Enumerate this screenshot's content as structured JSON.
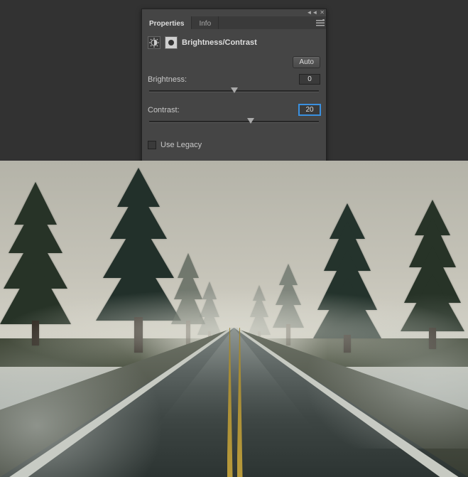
{
  "tabs": {
    "properties": "Properties",
    "info": "Info"
  },
  "adjustment": {
    "title": "Brightness/Contrast",
    "auto_label": "Auto",
    "brightness_label": "Brightness:",
    "brightness_value": "0",
    "contrast_label": "Contrast:",
    "contrast_value": "20",
    "use_legacy_label": "Use Legacy"
  }
}
